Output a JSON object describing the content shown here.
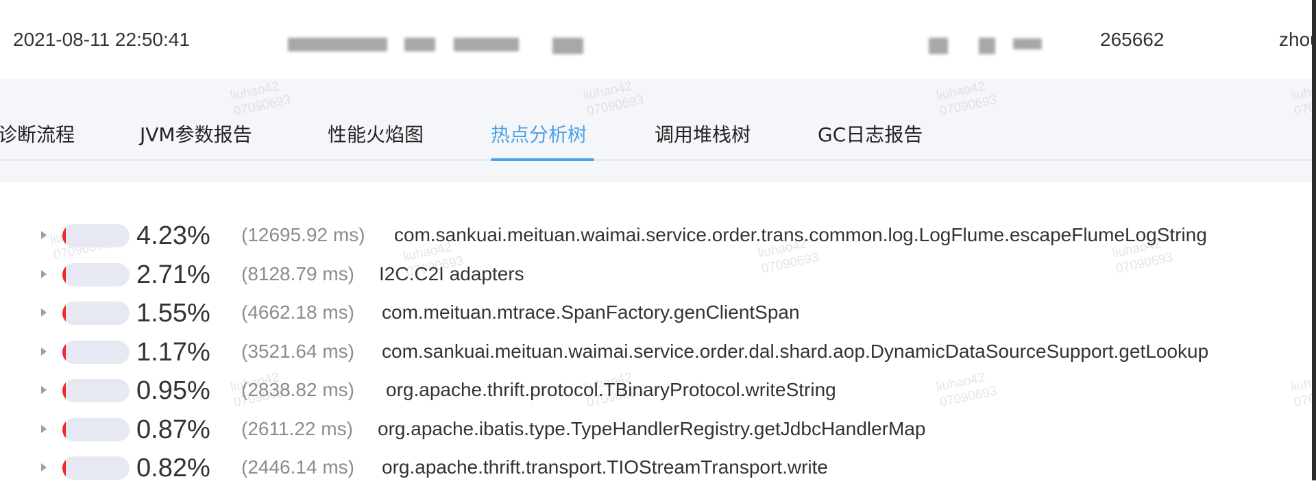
{
  "header": {
    "timestamp": "2021-08-11 22:50:41",
    "count": "265662",
    "user": "zhou"
  },
  "tabs": [
    {
      "label": "诊断流程",
      "active": false
    },
    {
      "label": "JVM参数报告",
      "active": false
    },
    {
      "label": "性能火焰图",
      "active": false
    },
    {
      "label": "热点分析树",
      "active": true
    },
    {
      "label": "调用堆栈树",
      "active": false
    },
    {
      "label": "GC日志报告",
      "active": false
    }
  ],
  "watermark": {
    "line1": "liuhao42",
    "line2": "07090693"
  },
  "hot_rows": [
    {
      "percent": "4.23%",
      "fraction": 0.0423,
      "duration": "(12695.92 ms)",
      "method": "com.sankuai.meituan.waimai.service.order.trans.common.log.LogFlume.escapeFlumeLogString"
    },
    {
      "percent": "2.71%",
      "fraction": 0.0271,
      "duration": "(8128.79 ms)",
      "method": "I2C.C2I adapters"
    },
    {
      "percent": "1.55%",
      "fraction": 0.0155,
      "duration": "(4662.18 ms)",
      "method": "com.meituan.mtrace.SpanFactory.genClientSpan"
    },
    {
      "percent": "1.17%",
      "fraction": 0.0117,
      "duration": "(3521.64 ms)",
      "method": "com.sankuai.meituan.waimai.service.order.dal.shard.aop.DynamicDataSourceSupport.getLookup"
    },
    {
      "percent": "0.95%",
      "fraction": 0.0095,
      "duration": "(2838.82 ms)",
      "method": "org.apache.thrift.protocol.TBinaryProtocol.writeString"
    },
    {
      "percent": "0.87%",
      "fraction": 0.0087,
      "duration": "(2611.22 ms)",
      "method": "org.apache.ibatis.type.TypeHandlerRegistry.getJdbcHandlerMap"
    },
    {
      "percent": "0.82%",
      "fraction": 0.0082,
      "duration": "(2446.14 ms)",
      "method": "org.apache.thrift.transport.TIOStreamTransport.write"
    }
  ],
  "colors": {
    "accent": "#4ea1e8",
    "bar_fill": "#f0262b",
    "bar_track": "#e6e9f2"
  }
}
